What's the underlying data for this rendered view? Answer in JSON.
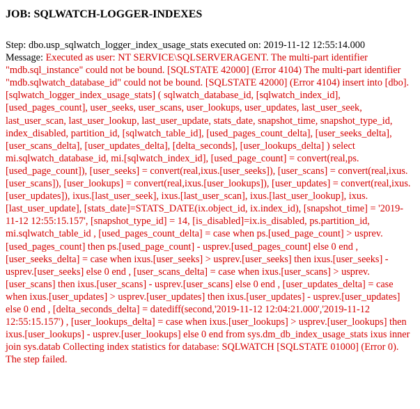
{
  "job": {
    "title": "JOB: SQLWATCH-LOGGER-INDEXES"
  },
  "step": {
    "label": "Step: dbo.usp_sqlwatch_logger_index_usage_stats executed on: 2019-11-12 12:55:14.000"
  },
  "message": {
    "label": "Message:",
    "text": "Executed as user: NT SERVICE\\SQLSERVERAGENT. The multi-part identifier \"mdb.sql_instance\" could not be bound. [SQLSTATE 42000] (Error 4104) The multi-part identifier \"mdb.sqlwatch_database_id\" could not be bound. [SQLSTATE 42000] (Error 4104) insert into [dbo].[sqlwatch_logger_index_usage_stats] ( sqlwatch_database_id, [sqlwatch_index_id], [used_pages_count], user_seeks, user_scans, user_lookups, user_updates, last_user_seek, last_user_scan, last_user_lookup, last_user_update, stats_date, snapshot_time, snapshot_type_id, index_disabled, partition_id, [sqlwatch_table_id], [used_pages_count_delta], [user_seeks_delta], [user_scans_delta], [user_updates_delta], [delta_seconds], [user_lookups_delta] ) select mi.sqlwatch_database_id, mi.[sqlwatch_index_id], [used_page_count] = convert(real,ps.[used_page_count]), [user_seeks] = convert(real,ixus.[user_seeks]), [user_scans] = convert(real,ixus.[user_scans]), [user_lookups] = convert(real,ixus.[user_lookups]), [user_updates] = convert(real,ixus.[user_updates]), ixus.[last_user_seek], ixus.[last_user_scan], ixus.[last_user_lookup], ixus.[last_user_update], [stats_date]=STATS_DATE(ix.object_id, ix.index_id), [snapshot_time] = '2019-11-12 12:55:15.157', [snapshot_type_id] = 14, [is_disabled]=ix.is_disabled, ps.partition_id, mi.sqlwatch_table_id , [used_pages_count_delta] = case when ps.[used_page_count] > usprev.[used_pages_count] then ps.[used_page_count] - usprev.[used_pages_count] else 0 end , [user_seeks_delta] = case when ixus.[user_seeks] > usprev.[user_seeks] then ixus.[user_seeks] - usprev.[user_seeks] else 0 end , [user_scans_delta] = case when ixus.[user_scans] > usprev.[user_scans] then ixus.[user_scans] - usprev.[user_scans] else 0 end , [user_updates_delta] = case when ixus.[user_updates] > usprev.[user_updates] then ixus.[user_updates] - usprev.[user_updates] else 0 end , [delta_seconds_delta] = datediff(second,'2019-11-12 12:04:21.000','2019-11-12 12:55:15.157') , [user_lookups_delta] = case when ixus.[user_lookups] > usprev.[user_lookups] then ixus.[user_lookups] - usprev.[user_lookups] else 0 end from sys.dm_db_index_usage_stats ixus inner join sys.datab Collecting index statistics for database: SQLWATCH [SQLSTATE 01000] (Error 0). The step failed."
  },
  "colors": {
    "text": "#000000",
    "error": "#d50000",
    "background": "#ffffff"
  }
}
